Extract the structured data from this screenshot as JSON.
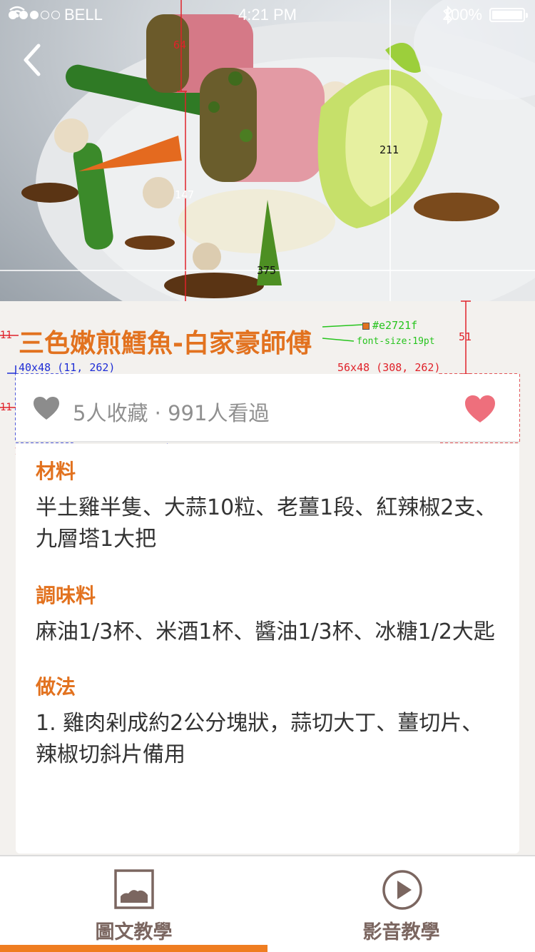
{
  "status_bar": {
    "carrier": "BELL",
    "time": "4:21 PM",
    "battery": "100%",
    "signal_dots_filled": 3,
    "signal_dots_total": 5
  },
  "hero": {
    "description_icon": "dish-photo",
    "back_icon": "chevron-left-icon"
  },
  "recipe": {
    "title": "三色嫩煎鱈魚-白家豪師傅",
    "stats": "5人收藏 · 991人看過"
  },
  "sections": [
    {
      "heading": "材料",
      "text": "半土雞半隻、大蒜10粒、老薑1段、紅辣椒2支、九層塔1大把"
    },
    {
      "heading": "調味料",
      "text": "麻油1/3杯、米酒1杯、醬油1/3杯、冰糖1/2大匙"
    },
    {
      "heading": "做法",
      "text": "1.  雞肉剁成約2公分塊狀，蒜切大丁、薑切片、辣椒切斜片備用"
    }
  ],
  "tabs": [
    {
      "label": "圖文教學",
      "icon": "image-icon",
      "active": true
    },
    {
      "label": "影音教學",
      "icon": "play-icon",
      "active": false
    }
  ],
  "annotations": {
    "top_gap": "64",
    "image_height": "147",
    "half_height": "211",
    "half_width": "375",
    "title_gap": "51",
    "left_margin": "11",
    "left_margin_2": "11",
    "heart_size": "40x48 (11, 262)",
    "fav_size": "56x48 (308, 262)",
    "padding": "12",
    "title_color": "#e2721f",
    "title_font_size": "font-size:19pt",
    "divider_color": "#e5e5e5"
  },
  "colors": {
    "accent": "#e2721f",
    "tab_indicator": "#ef7d21",
    "heart_favorite": "#ee6f7c",
    "heart_small": "#8c8c8c",
    "divider": "#e5e5e5",
    "tab_text": "#7b6660"
  }
}
